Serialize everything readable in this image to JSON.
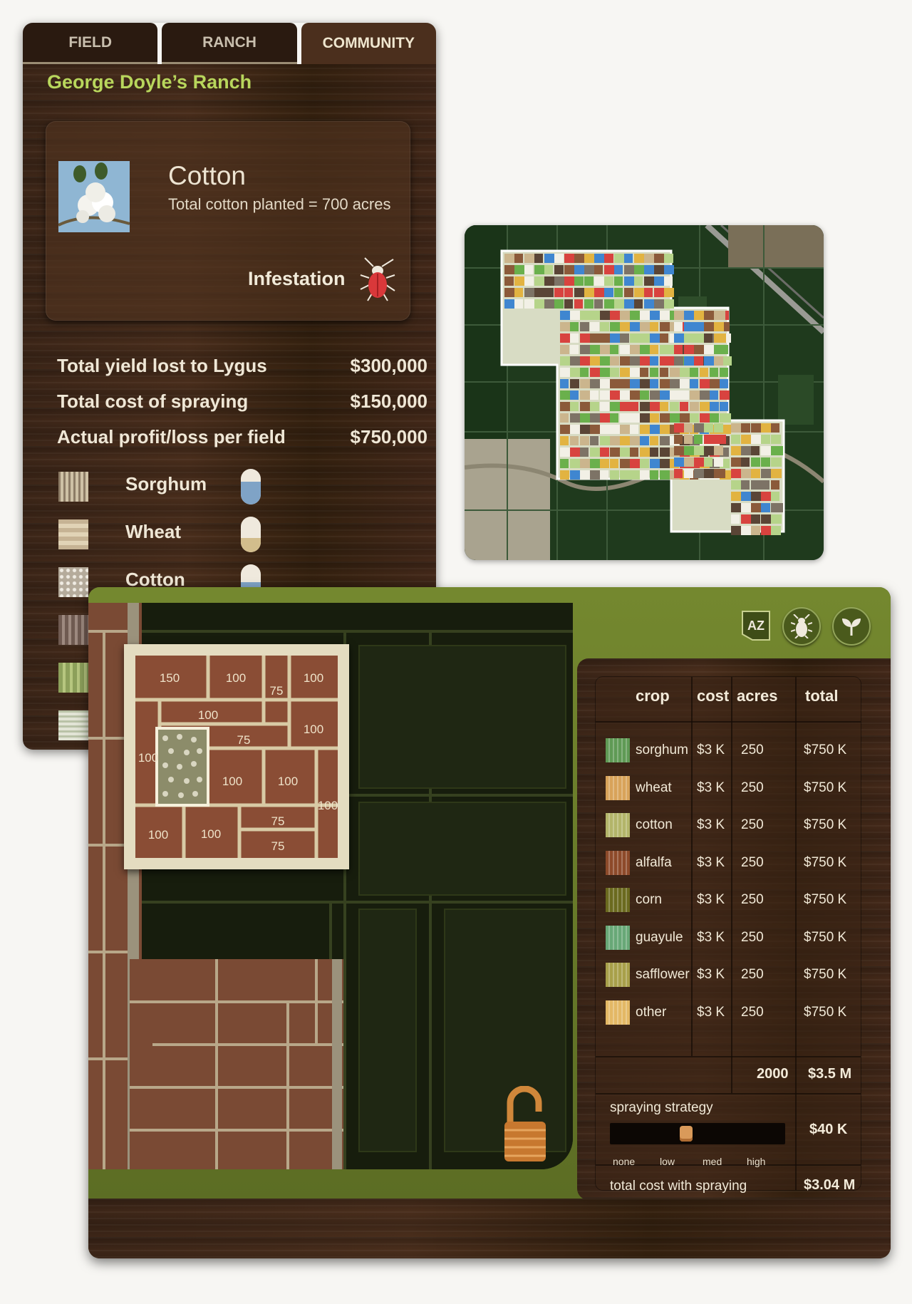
{
  "tabs": [
    {
      "label": "FIELD",
      "active": false
    },
    {
      "label": "RANCH",
      "active": false
    },
    {
      "label": "COMMUNITY",
      "active": true
    }
  ],
  "ranch_title": "George Doyle’s Ranch",
  "crop_card": {
    "name": "Cotton",
    "subtitle": "Total cotton planted = 700 acres",
    "infestation_label": "Infestation"
  },
  "stats": [
    {
      "label": "Total yield lost to Lygus",
      "value": "$300,000"
    },
    {
      "label": "Total cost of spraying",
      "value": "$150,000"
    },
    {
      "label": "Actual profit/loss per field",
      "value": "$750,000"
    }
  ],
  "legend": [
    {
      "label": "Sorghum",
      "level": 0.65,
      "fill_color": "#7fa3c6"
    },
    {
      "label": "Wheat",
      "level": 0.4,
      "fill_color": "#d2bd8c"
    },
    {
      "label": "Cotton",
      "level": 0.5,
      "fill_color": "#7fa3c6"
    },
    {
      "label": "",
      "level": 0,
      "fill_color": ""
    },
    {
      "label": "",
      "level": 0,
      "fill_color": ""
    },
    {
      "label": "",
      "level": 0,
      "fill_color": ""
    }
  ],
  "toolbar": {
    "state_label": "AZ",
    "bug_icon": "bug-icon",
    "plant_icon": "sprout-icon"
  },
  "field_plot": {
    "parcels": [
      "150",
      "100",
      "75",
      "100",
      "100",
      "100",
      "75",
      "100",
      "100",
      "100",
      "100",
      "100",
      "100",
      "75",
      "75"
    ]
  },
  "crop_table": {
    "headers": [
      "crop",
      "cost",
      "acres",
      "total"
    ],
    "rows": [
      {
        "crop": "sorghum",
        "cost": "$3 K",
        "acres": "250",
        "total": "$750 K",
        "swatch": "#5f9a55"
      },
      {
        "crop": "wheat",
        "cost": "$3 K",
        "acres": "250",
        "total": "$750 K",
        "swatch": "#d8a35a"
      },
      {
        "crop": "cotton",
        "cost": "$3 K",
        "acres": "250",
        "total": "$750 K",
        "swatch": "#b3b56a"
      },
      {
        "crop": "alfalfa",
        "cost": "$3 K",
        "acres": "250",
        "total": "$750 K",
        "swatch": "#8d4a2a"
      },
      {
        "crop": "corn",
        "cost": "$3 K",
        "acres": "250",
        "total": "$750 K",
        "swatch": "#6b6a1f"
      },
      {
        "crop": "guayule",
        "cost": "$3 K",
        "acres": "250",
        "total": "$750 K",
        "swatch": "#68a877"
      },
      {
        "crop": "safflower",
        "cost": "$3 K",
        "acres": "250",
        "total": "$750 K",
        "swatch": "#a8a04a"
      },
      {
        "crop": "other",
        "cost": "$3 K",
        "acres": "250",
        "total": "$750 K",
        "swatch": "#e3b865"
      }
    ],
    "total_acres": "2000",
    "total_value": "$3.5 M",
    "spraying_label": "spraying strategy",
    "spraying_levels": [
      "none",
      "low",
      "med",
      "high"
    ],
    "spraying_selected": "low",
    "spraying_cost": "$40 K",
    "total_cost_label": "total cost with spraying",
    "total_cost_value": "$3.04 M"
  }
}
